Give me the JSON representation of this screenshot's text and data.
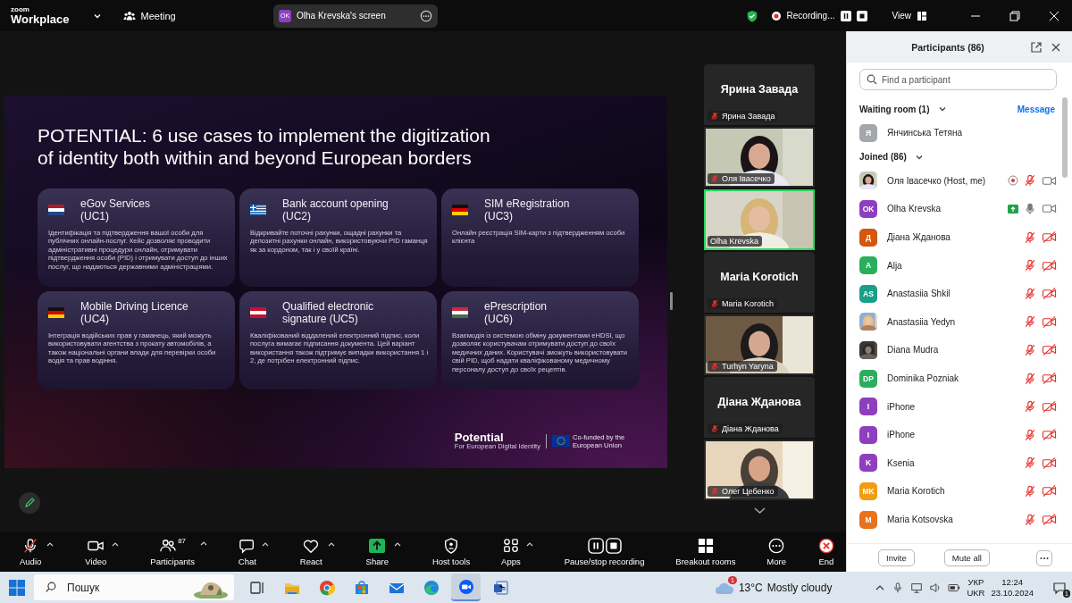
{
  "top_bar": {
    "logo_top": "zoom",
    "logo_bottom": "Workplace",
    "meeting": "Meeting",
    "share_pill": {
      "initials": "OK",
      "label": "Olha Krevska's screen"
    },
    "recording": "Recording...",
    "view": "View"
  },
  "slide": {
    "title_lines": [
      "POTENTIAL: 6 use cases to implement the digitization",
      "of identity both within and beyond European borders"
    ],
    "cards": [
      {
        "kind": "nl",
        "title_lines": [
          "eGov Services",
          "(UC1)"
        ],
        "text": "Ідентифікація та підтвердження вашої особи для публічних онлайн-послуг. Кейс дозволяє проводити адміністративні процедури онлайн, отримувати підтвердження особи (PID) і отримувати доступ до інших послуг, що надаються державними адміністраціями."
      },
      {
        "kind": "gr",
        "title_lines": [
          "Bank account opening",
          "(UC2)"
        ],
        "text": "Відкривайте поточні рахунки, ощадні рахунки та депозитні рахунки онлайн, використовуючи PID гаманця як за кордоном, так і у своїй країні."
      },
      {
        "kind": "de",
        "title_lines": [
          "SIM eRegistration",
          "(UC3)"
        ],
        "text": "Онлайн реєстрація SIM-карти з підтвердженням особи клієнта"
      },
      {
        "kind": "de",
        "title_lines": [
          "Mobile Driving Licence",
          "(UC4)"
        ],
        "text": "Інтеграція водійських прав у гаманець, який можуть використовувати агентства з прокату автомобілів, а також національні органи влади для перевірки особи водія та прав водіння."
      },
      {
        "kind": "at",
        "title_lines": [
          "Qualified electronic",
          "signature (UC5)"
        ],
        "text": "Кваліфікований віддалений електронний підпис, коли послуга вимагає підписання документа. Цей варіант використання також підтримує випадки використання 1 і 2, де потрібен електронний підпис."
      },
      {
        "kind": "hu",
        "title_lines": [
          "ePrescription",
          "(UC6)"
        ],
        "text": "Взаємодія із системою обміну документами eHDSI, що дозволяє користувачам отримувати доступ до своїх медичних даних. Користувачі зможуть використовувати свій PID, щоб надати кваліфікованому медичному персоналу доступ до своїх рецептів."
      }
    ],
    "logo": "Potential",
    "logo_sub": "For European Digital Identity",
    "eu_text": "Co-funded by the European Union"
  },
  "video_strip": {
    "tiles": [
      {
        "kind": "name",
        "name": "Ярина Завада",
        "label": "Ярина Завада",
        "muted": true,
        "speaking": false
      },
      {
        "kind": "video",
        "label": "Оля Івасечко",
        "muted": true,
        "speaking": false
      },
      {
        "kind": "video",
        "label": "Olha Krevska",
        "muted": false,
        "speaking": true
      },
      {
        "kind": "name",
        "name": "Maria Korotich",
        "label": "Maria Korotich",
        "muted": true,
        "speaking": false
      },
      {
        "kind": "video",
        "label": "Turhyn Yaryna",
        "muted": true,
        "speaking": false
      },
      {
        "kind": "name",
        "name": "Діана Жданова",
        "label": "Діана Жданова",
        "muted": true,
        "speaking": false
      },
      {
        "kind": "video",
        "label": "Олег Цебенко",
        "muted": true,
        "speaking": false
      }
    ]
  },
  "participants": {
    "title": "Participants (86)",
    "search": {
      "placeholder": "Find a participant"
    },
    "waiting": {
      "label": "Waiting room (1)",
      "action": "Message",
      "people": [
        {
          "name": "Янчинська Тетяна",
          "kind": "initials",
          "initials": "Я",
          "color": "#a3a6ab"
        }
      ]
    },
    "joined": {
      "label": "Joined (86)",
      "people": [
        {
          "name": "Оля Івасечко (Host, me)",
          "recording": true,
          "sharing": false,
          "mic_muted": true,
          "video_on": true
        },
        {
          "name": "Olha Krevska",
          "kind": "initials",
          "initials": "OK",
          "color": "#8e3fbf",
          "recording": false,
          "sharing": true,
          "mic_muted": false,
          "video_on": true
        },
        {
          "name": "Діана Жданова",
          "kind": "initials",
          "initials": "Д",
          "color": "#d4560f",
          "recording": false,
          "sharing": false,
          "mic_muted": true,
          "video_on": false
        },
        {
          "name": "Alja",
          "kind": "initials",
          "initials": "A",
          "color": "#2aae5c",
          "recording": false,
          "sharing": false,
          "mic_muted": true,
          "video_on": false
        },
        {
          "name": "Anastasiia Shkil",
          "kind": "initials",
          "initials": "AS",
          "color": "#17a088",
          "recording": false,
          "sharing": false,
          "mic_muted": true,
          "video_on": false
        },
        {
          "name": "Anastasiia Yedyn",
          "recording": false,
          "sharing": false,
          "mic_muted": true,
          "video_on": false
        },
        {
          "name": "Diana Mudra",
          "recording": false,
          "sharing": false,
          "mic_muted": true,
          "video_on": false
        },
        {
          "name": "Dominika Pozniak",
          "kind": "initials",
          "initials": "DP",
          "color": "#2aae5c",
          "recording": false,
          "sharing": false,
          "mic_muted": true,
          "video_on": false
        },
        {
          "name": "iPhone",
          "kind": "initials",
          "initials": "I",
          "color": "#8e3fbf",
          "recording": false,
          "sharing": false,
          "mic_muted": true,
          "video_on": false
        },
        {
          "name": "iPhone",
          "kind": "initials",
          "initials": "I",
          "color": "#8e3fbf",
          "recording": false,
          "sharing": false,
          "mic_muted": true,
          "video_on": false
        },
        {
          "name": "Ksenia",
          "kind": "initials",
          "initials": "K",
          "color": "#8e3fbf",
          "recording": false,
          "sharing": false,
          "mic_muted": true,
          "video_on": false
        },
        {
          "name": "Maria Korotich",
          "kind": "initials",
          "initials": "MK",
          "color": "#f29d12",
          "recording": false,
          "sharing": false,
          "mic_muted": true,
          "video_on": false
        },
        {
          "name": "Maria Kotsovska",
          "kind": "initials",
          "initials": "M",
          "color": "#e8731c",
          "recording": false,
          "sharing": false,
          "mic_muted": true,
          "video_on": false
        }
      ]
    },
    "buttons": [
      "Invite",
      "Mute all"
    ]
  },
  "toolbar": [
    {
      "kind": "audio",
      "label": "Audio",
      "muted": true,
      "caret": true
    },
    {
      "kind": "video",
      "label": "Video",
      "caret": true
    },
    {
      "kind": "participants",
      "label": "Participants",
      "count": "87",
      "caret": true
    },
    {
      "kind": "chat",
      "label": "Chat",
      "caret": true
    },
    {
      "kind": "react",
      "label": "React",
      "caret": true
    },
    {
      "kind": "share",
      "label": "Share",
      "caret": true
    },
    {
      "kind": "host-tools",
      "label": "Host tools",
      "caret": false
    },
    {
      "kind": "apps",
      "label": "Apps",
      "caret": true
    },
    {
      "kind": "recording",
      "label": "Pause/stop recording",
      "caret": false
    },
    {
      "kind": "breakout",
      "label": "Breakout rooms",
      "caret": false
    },
    {
      "kind": "more",
      "label": "More",
      "caret": false
    },
    {
      "kind": "end",
      "label": "End",
      "caret": false
    }
  ],
  "taskbar": {
    "search": {
      "placeholder": "Пошук"
    },
    "apps": [
      {
        "kind": "task-view",
        "active": false
      },
      {
        "kind": "folder",
        "active": false
      },
      {
        "kind": "browser",
        "active": false
      },
      {
        "kind": "store",
        "active": false
      },
      {
        "kind": "mail",
        "active": false
      },
      {
        "kind": "edge",
        "active": false
      },
      {
        "kind": "video",
        "active": true
      },
      {
        "kind": "document",
        "active": false
      }
    ],
    "weather_badge": "1",
    "temperature": "13°C",
    "weather": "Mostly cloudy",
    "lang_top": "УКР",
    "lang_bottom": "UKR",
    "time": "12:24",
    "date": "23.10.2024",
    "notifications": "1"
  }
}
